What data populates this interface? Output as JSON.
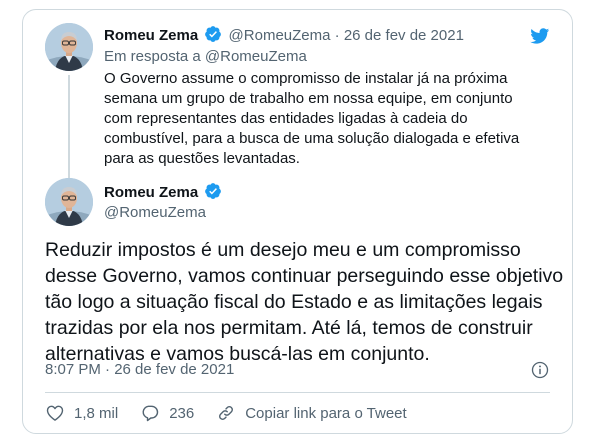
{
  "parent_tweet": {
    "name": "Romeu Zema",
    "handle": "@RomeuZema",
    "date": "26 de fev de 2021",
    "reply_prefix": "Em resposta a",
    "reply_to": "@RomeuZema",
    "text": "O Governo assume o compromisso de instalar já na próxima semana um grupo de trabalho em nossa equipe, em conjunto com representantes das entidades ligadas à cadeia do combustível, para a busca de uma solução dialogada e efetiva para as questões levantadas."
  },
  "main_tweet": {
    "name": "Romeu Zema",
    "handle": "@RomeuZema",
    "text": "Reduzir impostos é um desejo meu e um compromisso desse Governo, vamos continuar perseguindo esse objetivo tão logo a situação fiscal do Estado e as limitações legais trazidas por ela nos permitam. Até lá, temos de construir alternativas e vamos buscá-las em conjunto.",
    "timestamp": "8:07 PM · 26 de fev de 2021"
  },
  "actions": {
    "likes": "1,8 mil",
    "replies": "236",
    "copy_link": "Copiar link para o Tweet"
  },
  "icons": [
    "twitter-bird-icon",
    "verified-badge-icon",
    "info-icon",
    "heart-icon",
    "reply-icon",
    "share-icon"
  ],
  "colors": {
    "brand": "#1d9bf0",
    "text": "#0f1419",
    "muted": "#536471",
    "border": "#cfd9de"
  }
}
